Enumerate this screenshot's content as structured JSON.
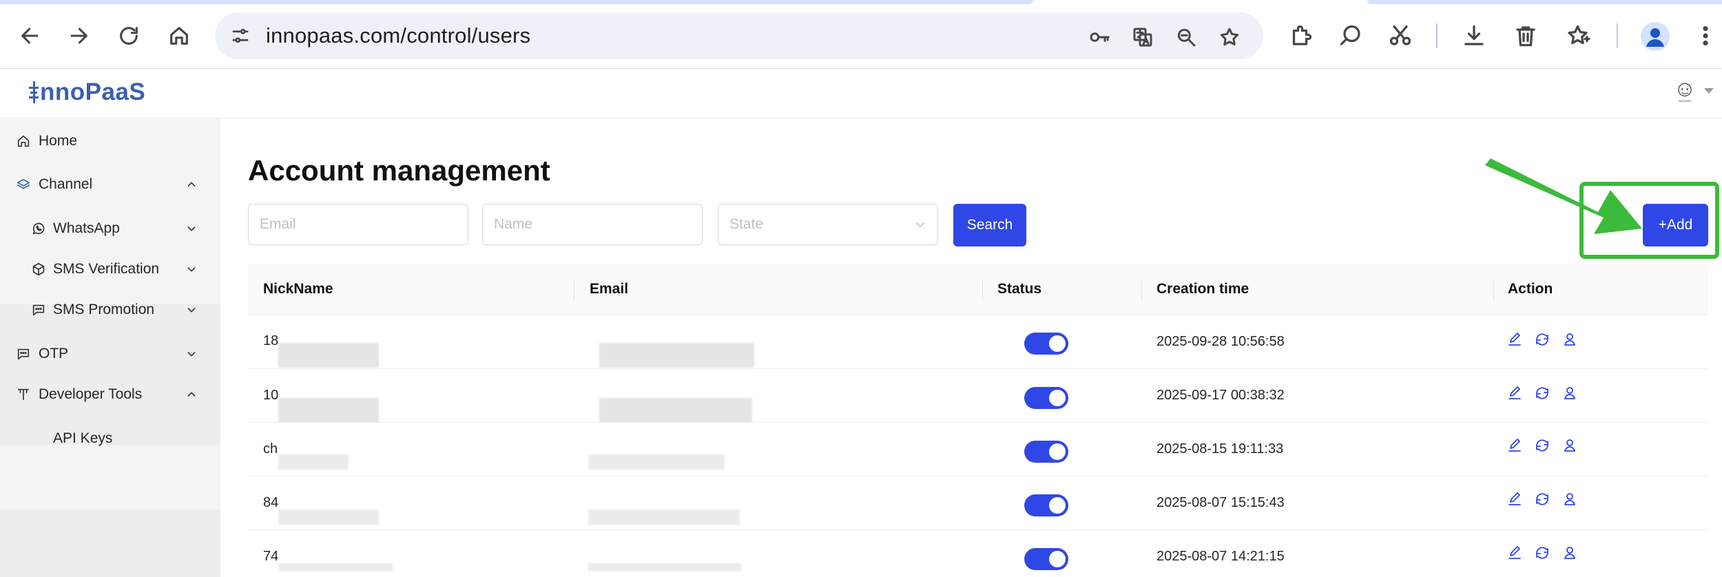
{
  "browser": {
    "url": "innopaas.com/control/users",
    "icons": [
      "back-icon",
      "forward-icon",
      "reload-icon",
      "home-icon",
      "site-info-icon",
      "password-key-icon",
      "translate-icon",
      "zoom-icon",
      "bookmark-star-icon",
      "extensions-icon",
      "search-lens-icon",
      "scissors-icon",
      "download-icon",
      "trash-icon",
      "reading-list-icon",
      "profile-icon",
      "menu-icon"
    ]
  },
  "app": {
    "logo_text": "nnoPaaS"
  },
  "sidebar": {
    "items": [
      {
        "label": "Home",
        "icon": "home-icon"
      },
      {
        "label": "Channel",
        "icon": "layers-icon",
        "expanded": true
      },
      {
        "label": "WhatsApp",
        "icon": "whatsapp-icon"
      },
      {
        "label": "SMS Verification",
        "icon": "cube-icon"
      },
      {
        "label": "SMS Promotion",
        "icon": "chat-dots-icon"
      },
      {
        "label": "OTP",
        "icon": "chat-dots-icon"
      },
      {
        "label": "Developer Tools",
        "icon": "tool-icon",
        "expanded": true
      },
      {
        "label": "API Keys"
      }
    ]
  },
  "page": {
    "title": "Account management",
    "filters": {
      "email_placeholder": "Email",
      "name_placeholder": "Name",
      "state_placeholder": "State"
    },
    "search_label": "Search",
    "add_label": "+Add"
  },
  "table": {
    "columns": [
      "NickName",
      "Email",
      "Status",
      "Creation time",
      "Action"
    ],
    "rows": [
      {
        "nick": "18",
        "status_on": true,
        "created": "2025-09-28 10:56:58"
      },
      {
        "nick": "10",
        "status_on": true,
        "created": "2025-09-17 00:38:32"
      },
      {
        "nick": "ch",
        "status_on": true,
        "created": "2025-08-15 19:11:33"
      },
      {
        "nick": "84",
        "status_on": true,
        "created": "2025-08-07 15:15:43"
      },
      {
        "nick": "74",
        "status_on": true,
        "created": "2025-08-07 14:21:15"
      }
    ],
    "action_icons": [
      "edit-icon",
      "reset-icon",
      "user-icon"
    ]
  },
  "colors": {
    "primary": "#2f47e6",
    "highlight": "#3cba3c",
    "logo": "#3a5fb0"
  }
}
